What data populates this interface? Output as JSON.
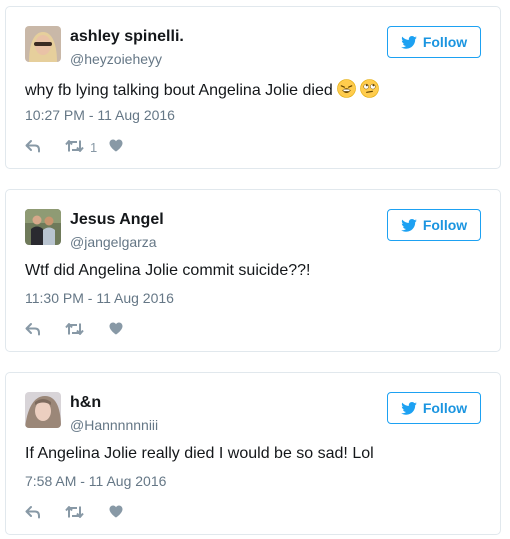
{
  "tweets": [
    {
      "name": "ashley spinelli.",
      "handle": "@heyzoieheyy",
      "follow_label": "Follow",
      "text": "why fb lying talking bout Angelina Jolie died",
      "emojis": [
        "weary-face-emoji",
        "face-with-rolling-eyes-emoji"
      ],
      "timestamp": "10:27 PM - 11 Aug 2016",
      "retweet_count": "1",
      "avatar": "woman-selfie-avatar"
    },
    {
      "name": "Jesus Angel",
      "handle": "@jangelgarza",
      "follow_label": "Follow",
      "text": "Wtf did Angelina Jolie commit suicide??!",
      "timestamp": "11:30 PM - 11 Aug 2016",
      "retweet_count": "",
      "avatar": "couple-photo-avatar"
    },
    {
      "name": "h&n",
      "handle": "@Hannnnnniii",
      "follow_label": "Follow",
      "text": "If Angelina Jolie really died I would be so sad! Lol",
      "timestamp": "7:58 AM - 11 Aug 2016",
      "retweet_count": "",
      "avatar": "woman-selfie-avatar"
    }
  ],
  "icons": {
    "follow": "twitter-bird-icon",
    "reply": "reply-icon",
    "retweet": "retweet-icon",
    "like": "heart-icon"
  },
  "colors": {
    "accent": "#1da1f2",
    "follow_text": "#1b95e0",
    "name": "#14171a",
    "secondary": "#657786",
    "action_icons": "#8899a6",
    "card_border": "#e1e8ed"
  }
}
